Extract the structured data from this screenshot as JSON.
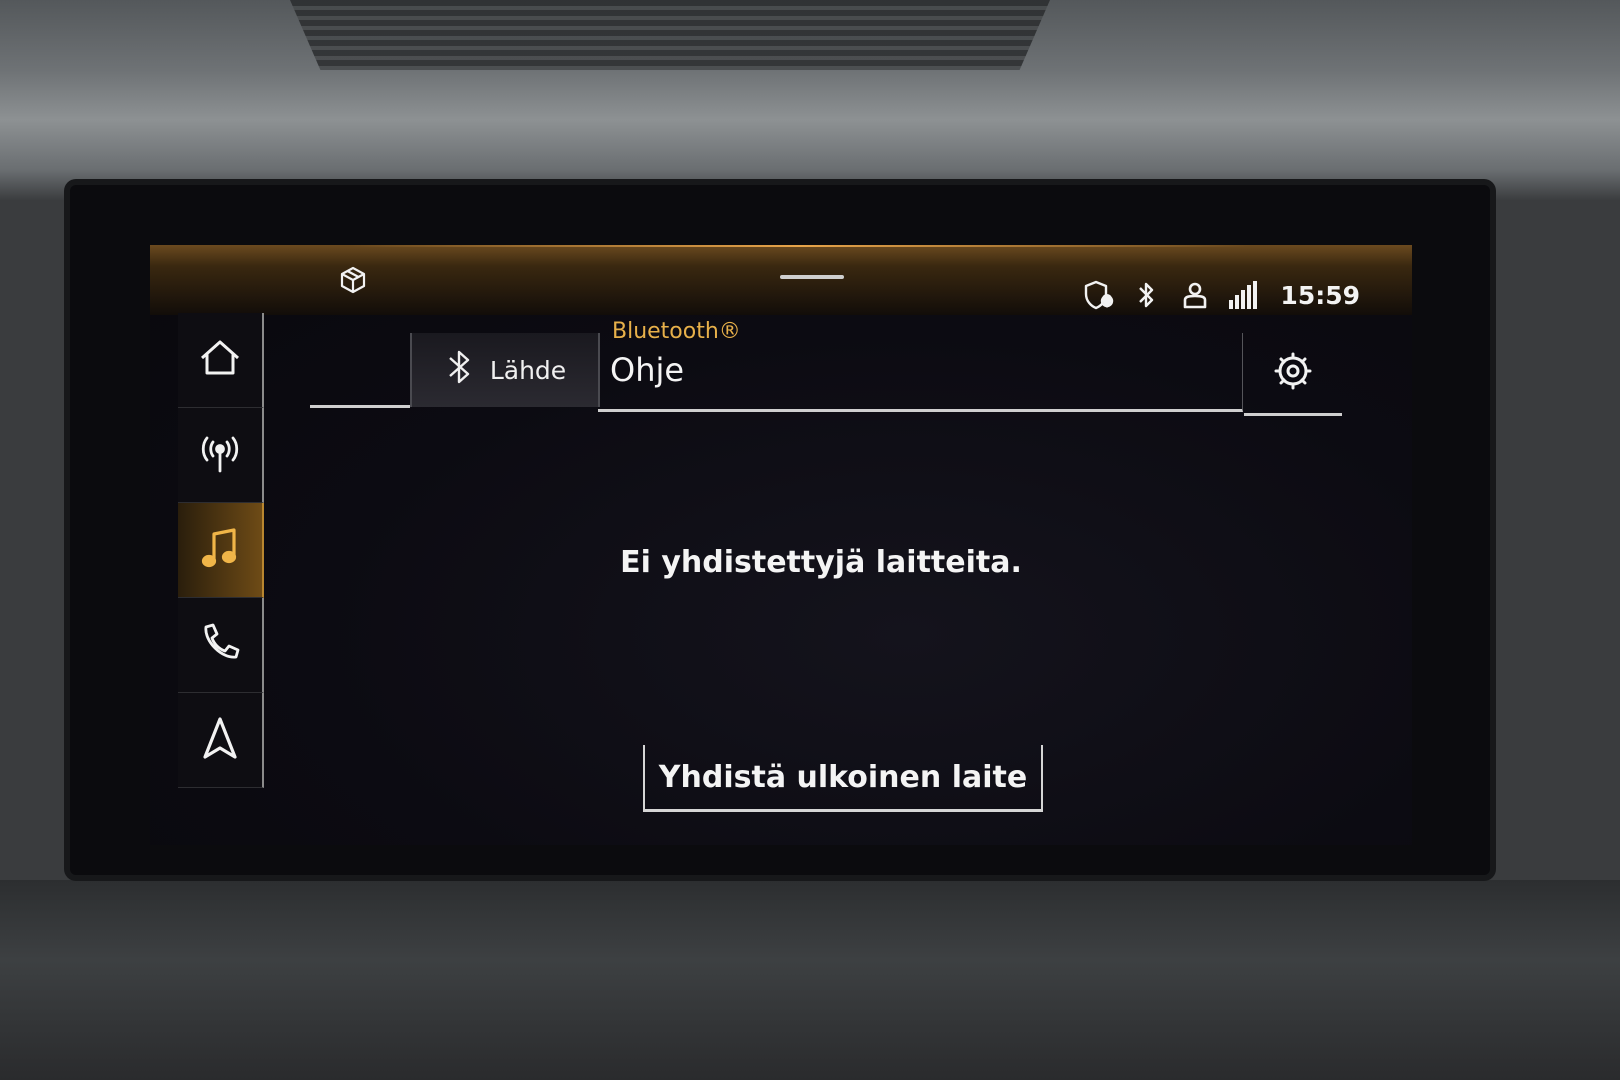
{
  "status_bar": {
    "time": "15:59",
    "icons": [
      "cube-icon",
      "shield-location-icon",
      "bluetooth-icon",
      "user-profile-icon",
      "lte-signal-icon"
    ]
  },
  "sidebar": {
    "items": [
      {
        "name": "home",
        "icon": "home-icon",
        "active": false
      },
      {
        "name": "radio",
        "icon": "radio-antenna-icon",
        "active": false
      },
      {
        "name": "media",
        "icon": "music-note-icon",
        "active": true
      },
      {
        "name": "phone",
        "icon": "phone-icon",
        "active": false
      },
      {
        "name": "navigation",
        "icon": "navigation-arrow-icon",
        "active": false
      }
    ]
  },
  "header": {
    "source_label": "Lähde",
    "source_icon": "bluetooth-icon",
    "subtitle": "Bluetooth®",
    "title": "Ohje",
    "settings_icon": "gear-icon"
  },
  "content": {
    "message": "Ei yhdistettyjä laitteita.",
    "connect_button_label": "Yhdistä ulkoinen laite"
  },
  "colors": {
    "accent": "#e7b04a",
    "background": "#0c0b12",
    "text": "#f4f4f4"
  }
}
